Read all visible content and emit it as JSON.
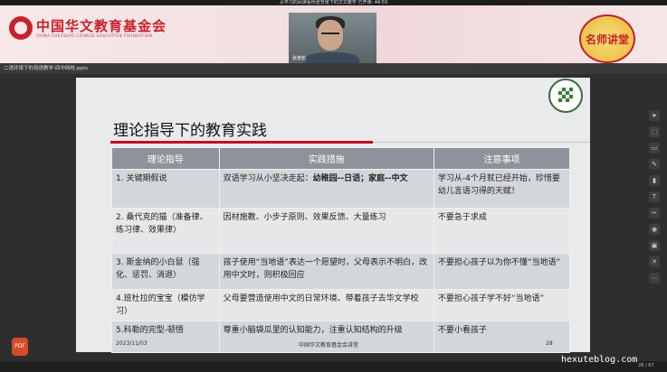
{
  "window": {
    "title": "从学习的阅读看侨居背景下的华文教学  已开课: 44:59"
  },
  "banner": {
    "org_name": "中国华文教育基金会",
    "org_subtitle": "CHINA OVERSEAS CHINESE EDUCATION FOUNDATION",
    "badge": "名师讲堂"
  },
  "video": {
    "speaker_name": "张老松"
  },
  "file": {
    "name": "二语环境下的母语教学-四中网校.pptx"
  },
  "slide": {
    "title": "理论指导下的教育实践",
    "headers": [
      "理论指导",
      "实践措施",
      "注意事项"
    ],
    "rows": [
      {
        "theory": "1. 关键期假说",
        "practice": "双语学习从小坚决走起：",
        "practice_bold": "幼稚园--日语；家庭--中文",
        "note": "学习从-4个月就已经开始，珍惜要幼儿言语习得的天赋！"
      },
      {
        "theory": "2. 桑代克的猫（准备律、练习律、效果律）",
        "practice": "因材施教、小步子原则、效果反馈、大量练习",
        "practice_bold": "",
        "note": "不要急于求成"
      },
      {
        "theory": "3. 斯金纳的小白鼠（强化、惩罚、消退）",
        "practice": "孩子使用“当地语”表达一个愿望时，父母表示不明白，改用中文时，则积极回应",
        "practice_bold": "",
        "note": "不要担心孩子以为你不懂“当地语”"
      },
      {
        "theory": "4.班杜拉的宝宝（模仿学习）",
        "practice": "父母要营造使用中文的日常环境、带着孩子去华文学校",
        "practice_bold": "",
        "note": "不要担心孩子学不好“当地语”"
      },
      {
        "theory": "5.科勒的完型-顿悟",
        "practice": "尊重小脑袋瓜里的认知能力，注重认知结构的升级",
        "practice_bold": "",
        "note": "不要小看孩子"
      }
    ],
    "footer_date": "2023/11/03",
    "footer_org": "中国华文教育基金会讲堂",
    "page_number": "28"
  },
  "sidebar_tools": [
    "pointer-icon",
    "select-icon",
    "eraser-icon",
    "pen-icon",
    "highlighter-icon",
    "text-icon",
    "scissors-icon",
    "record-icon",
    "image-icon",
    "close-icon",
    "more-icon"
  ],
  "bottom": {
    "page_indicator": "28 / 67",
    "watermark": "hexuteblog.com",
    "pdf_label": "PDF"
  }
}
